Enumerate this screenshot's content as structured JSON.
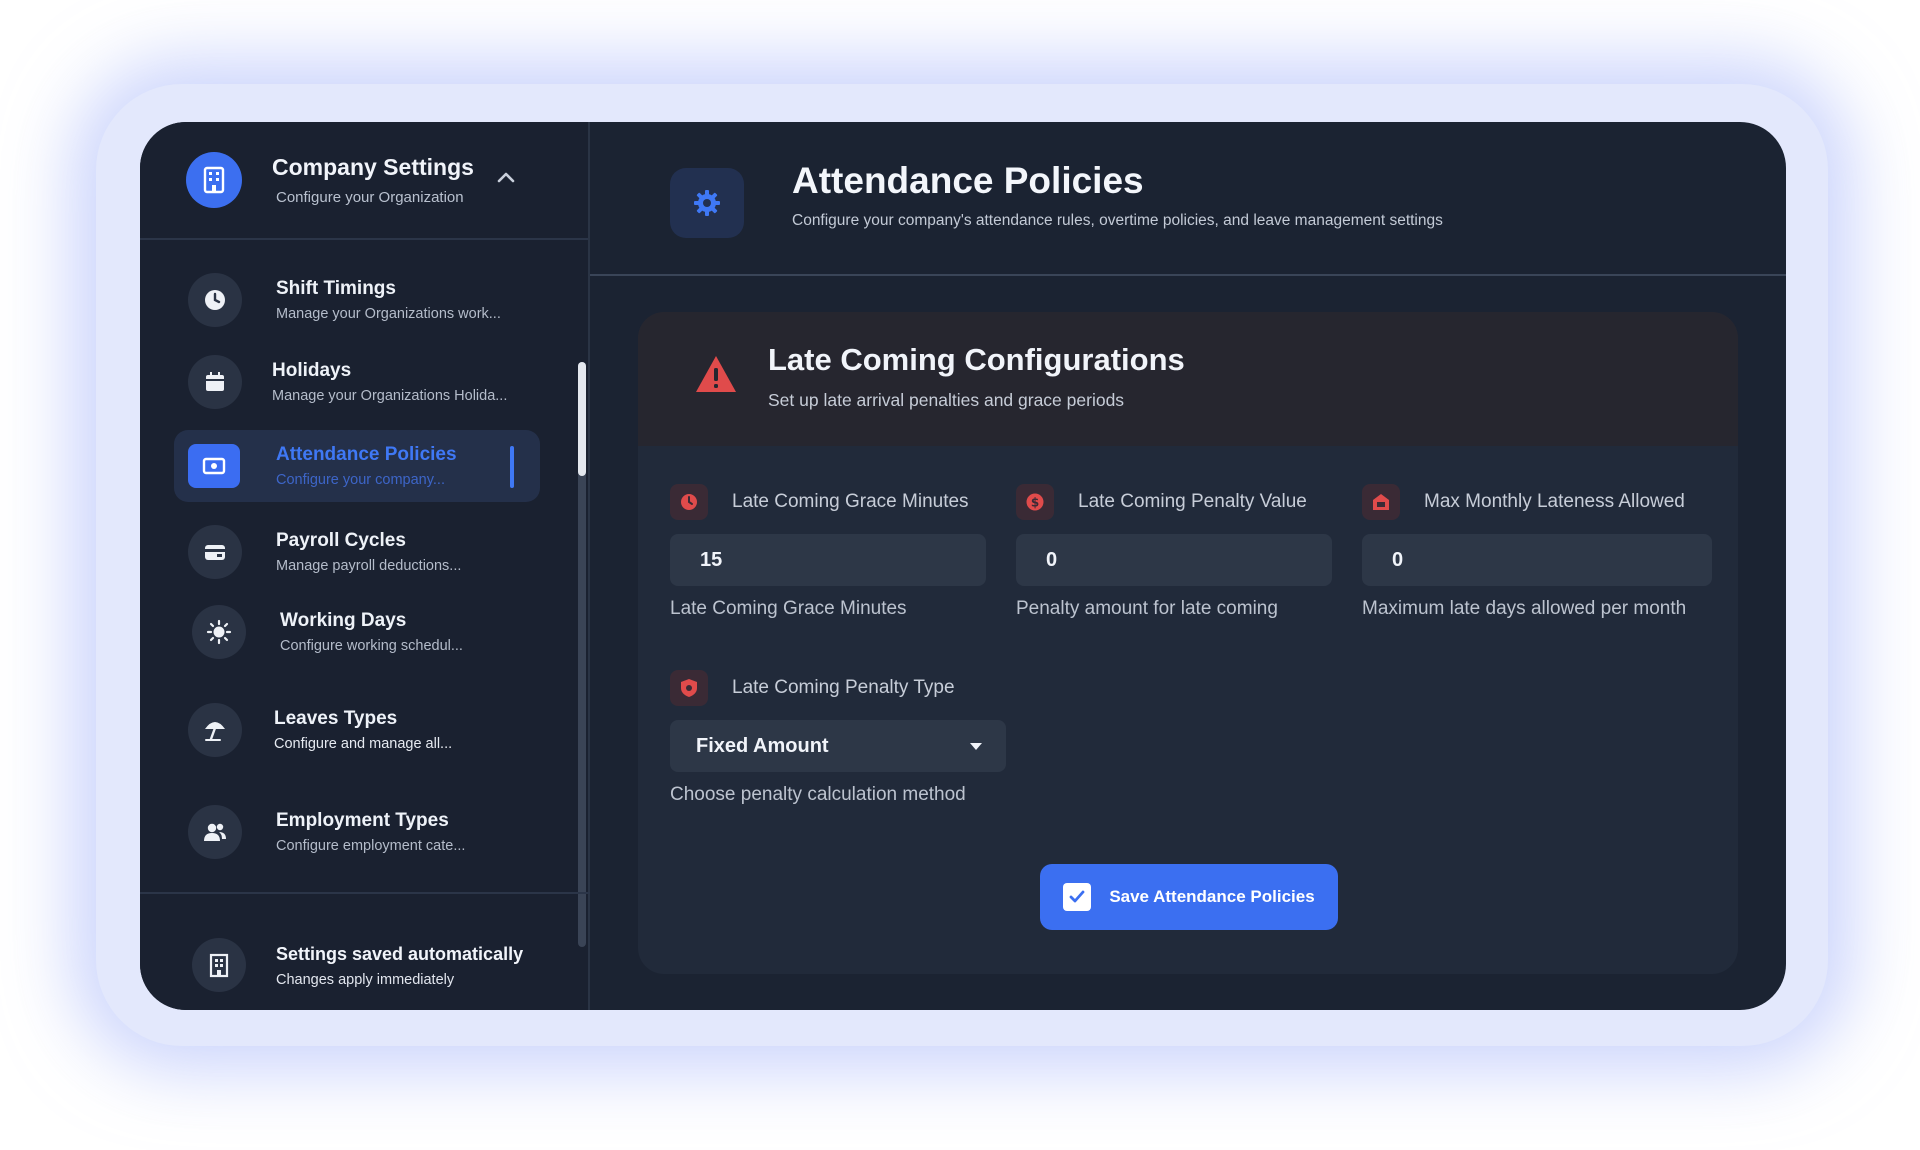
{
  "sidebar": {
    "header": {
      "title": "Company Settings",
      "subtitle": "Configure your Organization",
      "icon": "building-icon"
    },
    "items": [
      {
        "title": "Shift Timings",
        "subtitle": "Manage your Organizations work...",
        "icon": "clock-icon"
      },
      {
        "title": "Holidays",
        "subtitle": "Manage your Organizations Holida...",
        "icon": "calendar-icon"
      },
      {
        "title": "Attendance Policies",
        "subtitle": "Configure your company...",
        "icon": "policy-icon",
        "active": true
      },
      {
        "title": "Payroll Cycles",
        "subtitle": "Manage payroll deductions...",
        "icon": "wallet-icon"
      },
      {
        "title": "Working Days",
        "subtitle": "Configure working schedul...",
        "icon": "sun-icon"
      },
      {
        "title": "Leaves Types",
        "subtitle": "Configure and manage all...",
        "icon": "beach-umbrella-icon"
      },
      {
        "title": "Employment Types",
        "subtitle": "Configure employment cate...",
        "icon": "people-icon"
      }
    ],
    "footer": {
      "title": "Settings saved automatically",
      "subtitle": "Changes apply immediately",
      "icon": "office-building-icon"
    }
  },
  "main": {
    "header": {
      "title": "Attendance Policies",
      "subtitle": "Configure your company's attendance rules, overtime policies, and leave management settings",
      "icon": "gear-icon"
    },
    "card": {
      "title": "Late Coming Configurations",
      "subtitle": "Set up late arrival penalties and grace periods",
      "icon": "warning-icon",
      "fields": {
        "grace": {
          "label": "Late Coming Grace Minutes",
          "value": "15",
          "help": "Late Coming Grace Minutes",
          "icon": "clock-icon"
        },
        "penalty_value": {
          "label": "Late Coming Penalty Value",
          "value": "0",
          "help": "Penalty amount for late coming",
          "icon": "dollar-icon"
        },
        "max_lateness": {
          "label": "Max Monthly Lateness Allowed",
          "value": "0",
          "help": "Maximum late days allowed per month",
          "icon": "calendar-alert-icon"
        },
        "penalty_type": {
          "label": "Late Coming Penalty Type",
          "value": "Fixed Amount",
          "help": "Choose penalty calculation method",
          "icon": "shield-icon"
        }
      },
      "save_button": {
        "label": "Save Attendance Policies",
        "icon": "checkbox-icon"
      }
    }
  },
  "colors": {
    "accent": "#3b6ff1",
    "danger": "#e04b4b",
    "background": "#1b2332",
    "sidebar": "#1a2130",
    "card": "#212a3a",
    "frame": "#e3e8fc"
  }
}
